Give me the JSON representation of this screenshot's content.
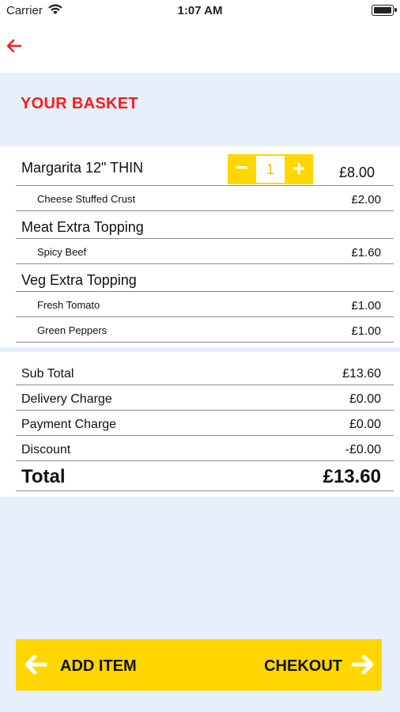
{
  "status_bar": {
    "carrier": "Carrier",
    "time": "1:07 AM"
  },
  "header": {
    "title": "YOUR BASKET"
  },
  "basket": {
    "item": {
      "name": "Margarita  12\" THIN",
      "quantity": "1",
      "price": "£8.00"
    },
    "lines": [
      {
        "type": "sub",
        "label": "Cheese Stuffed Crust",
        "price": "£2.00"
      },
      {
        "type": "category",
        "label": "Meat Extra Topping"
      },
      {
        "type": "sub",
        "label": "Spicy Beef",
        "price": "£1.60"
      },
      {
        "type": "category",
        "label": "Veg Extra Topping"
      },
      {
        "type": "sub",
        "label": "Fresh Tomato",
        "price": "£1.00"
      },
      {
        "type": "sub",
        "label": "Green Peppers",
        "price": "£1.00"
      }
    ]
  },
  "totals": {
    "sub_total_label": "Sub Total",
    "sub_total": "£13.60",
    "delivery_label": "Delivery Charge",
    "delivery": "£0.00",
    "payment_label": "Payment Charge",
    "payment": "£0.00",
    "discount_label": "Discount",
    "discount": "-£0.00",
    "total_label": "Total",
    "total": "£13.60"
  },
  "actions": {
    "add_item": "ADD ITEM",
    "checkout": "CHEKOUT"
  },
  "colors": {
    "accent": "#ffd600",
    "title": "#ff1a1a",
    "background": "#e6f0fb"
  },
  "icons": {
    "back": "arrow-left-icon",
    "add_item": "arrow-left-icon",
    "checkout": "arrow-right-icon"
  }
}
